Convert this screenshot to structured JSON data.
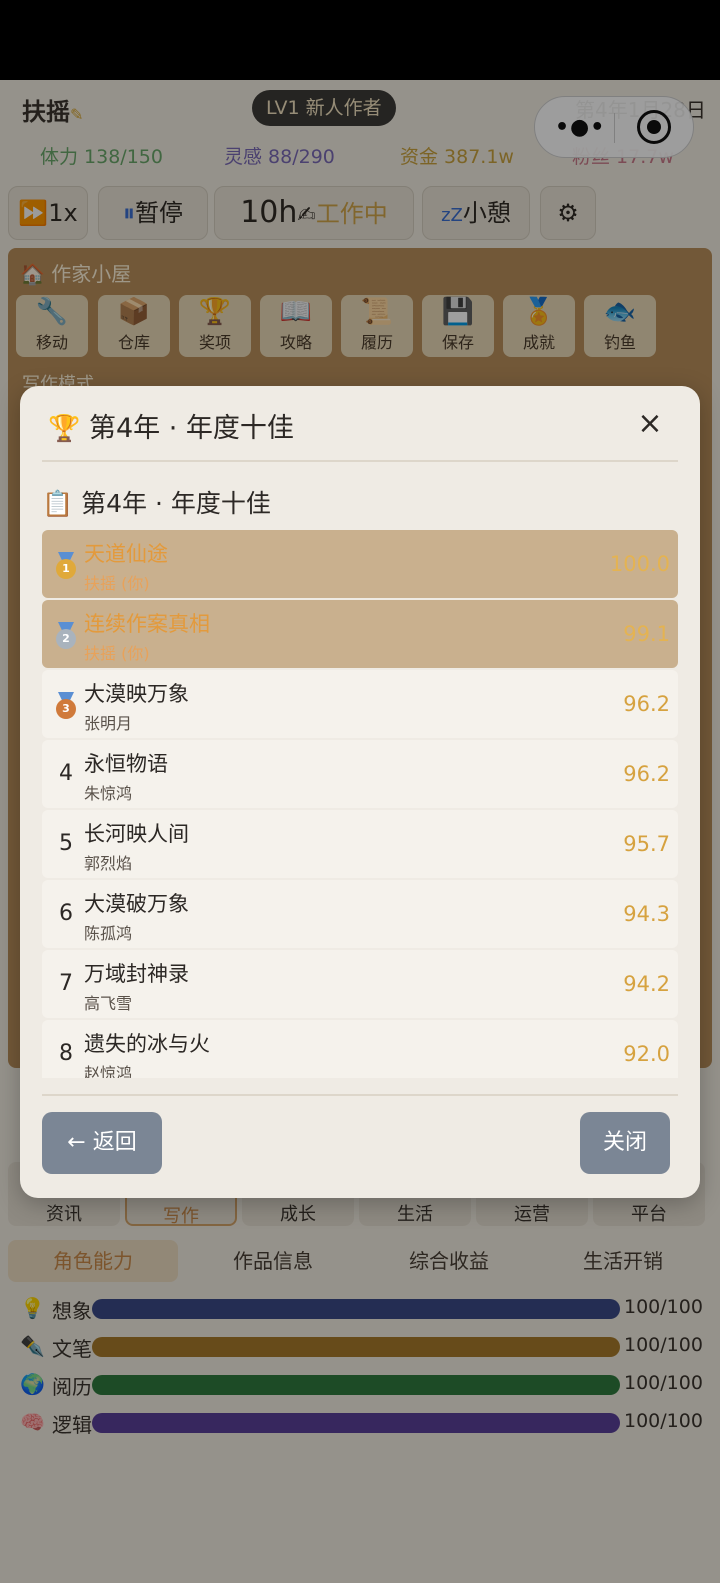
{
  "header": {
    "name": "扶摇",
    "badge": "LV1 新人作者",
    "date": "第4年1月28日",
    "stats": [
      {
        "text": "体力 138/150",
        "color": "#6aa66a"
      },
      {
        "text": "灵感 88/290",
        "color": "#7a6ab5"
      },
      {
        "text": "资金 387.1w",
        "color": "#c9a23e"
      },
      {
        "text": "粉丝 17.7w",
        "color": "#c97a8a"
      }
    ]
  },
  "toolbar": {
    "speed": "1x",
    "pause": "暂停",
    "hours": "10h",
    "working": "工作中",
    "rest": "小憩"
  },
  "room": {
    "title": "作家小屋",
    "mode": "写作模式",
    "buttons": [
      {
        "label": "移动",
        "icon": "🔧"
      },
      {
        "label": "仓库",
        "icon": "📦"
      },
      {
        "label": "奖项",
        "icon": "🏆"
      },
      {
        "label": "攻略",
        "icon": "📖"
      },
      {
        "label": "履历",
        "icon": "📜"
      },
      {
        "label": "保存",
        "icon": "💾"
      },
      {
        "label": "成就",
        "icon": "🏅"
      },
      {
        "label": "钓鱼",
        "icon": "🐟"
      }
    ]
  },
  "bottom_nav": [
    "资讯",
    "写作",
    "成长",
    "生活",
    "运营",
    "平台"
  ],
  "sub_tabs": [
    "角色能力",
    "作品信息",
    "综合收益",
    "生活开销"
  ],
  "abilities": [
    {
      "icon": "💡",
      "label": "想象",
      "value": "100/100",
      "level": 1.0,
      "color": "#3a4a86"
    },
    {
      "icon": "✒️",
      "label": "文笔",
      "value": "100/100",
      "level": 1.0,
      "color": "#a77a2a"
    },
    {
      "icon": "🌍",
      "label": "阅历",
      "value": "100/100",
      "level": 1.0,
      "color": "#2f7a3e"
    },
    {
      "icon": "🧠",
      "label": "逻辑",
      "value": "100/100",
      "level": 1.0,
      "color": "#5a3f98"
    }
  ],
  "modal": {
    "title": "第4年 · 年度十佳",
    "close_icon": "×",
    "list_title": "第4年 · 年度十佳",
    "rows": [
      {
        "rank": "1",
        "medal": "gold",
        "book": "天道仙途",
        "author": "扶摇 (你)",
        "score": "100.0",
        "highlight": true
      },
      {
        "rank": "2",
        "medal": "silver",
        "book": "连续作案真相",
        "author": "扶摇 (你)",
        "score": "99.1",
        "highlight": true
      },
      {
        "rank": "3",
        "medal": "bronze",
        "book": "大漠映万象",
        "author": "张明月",
        "score": "96.2",
        "highlight": false
      },
      {
        "rank": "4",
        "medal": "",
        "book": "永恒物语",
        "author": "朱惊鸿",
        "score": "96.2",
        "highlight": false
      },
      {
        "rank": "5",
        "medal": "",
        "book": "长河映人间",
        "author": "郭烈焰",
        "score": "95.7",
        "highlight": false
      },
      {
        "rank": "6",
        "medal": "",
        "book": "大漠破万象",
        "author": "陈孤鸿",
        "score": "94.3",
        "highlight": false
      },
      {
        "rank": "7",
        "medal": "",
        "book": "万域封神录",
        "author": "高飞雪",
        "score": "94.2",
        "highlight": false
      },
      {
        "rank": "8",
        "medal": "",
        "book": "遗失的冰与火",
        "author": "赵惊鸿",
        "score": "92.0",
        "highlight": false
      }
    ],
    "back_label": "← 返回",
    "close_label": "关闭"
  }
}
